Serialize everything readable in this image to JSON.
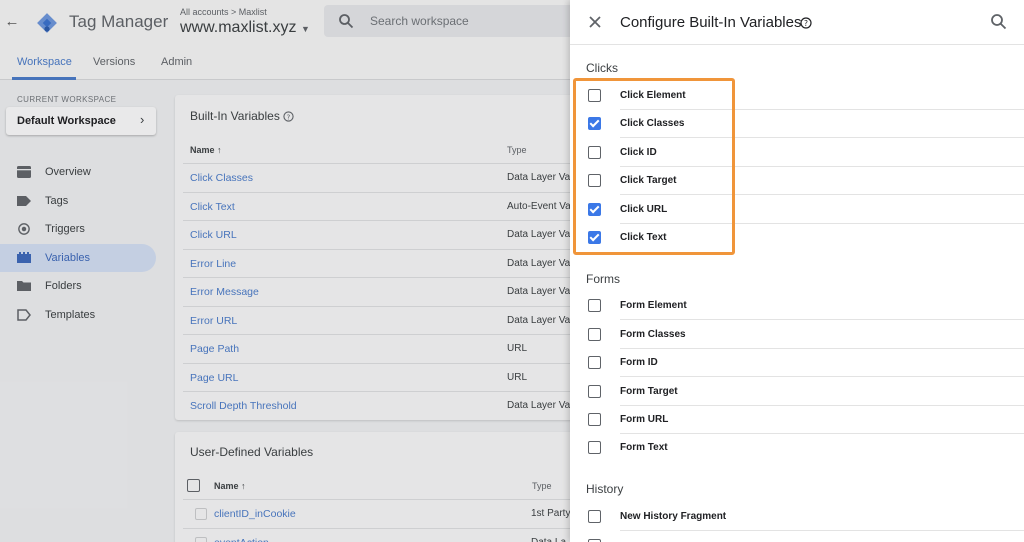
{
  "app": {
    "brand": "Tag Manager",
    "breadcrumb": "All accounts > Maxlist",
    "container_name": "www.maxlist.xyz",
    "search_placeholder": "Search workspace"
  },
  "nav_tabs": [
    {
      "label": "Workspace",
      "active": true
    },
    {
      "label": "Versions",
      "active": false
    },
    {
      "label": "Admin",
      "active": false
    }
  ],
  "sidebar": {
    "current_workspace_label": "CURRENT WORKSPACE",
    "workspace_name": "Default Workspace",
    "items": [
      {
        "label": "Overview",
        "icon": "overview-icon",
        "active": false
      },
      {
        "label": "Tags",
        "icon": "tag-icon",
        "active": false
      },
      {
        "label": "Triggers",
        "icon": "trigger-icon",
        "active": false
      },
      {
        "label": "Variables",
        "icon": "variables-icon",
        "active": true
      },
      {
        "label": "Folders",
        "icon": "folder-icon",
        "active": false
      },
      {
        "label": "Templates",
        "icon": "template-icon",
        "active": false
      }
    ]
  },
  "builtin_card": {
    "title": "Built-In Variables",
    "col_name": "Name ↑",
    "col_type": "Type",
    "rows": [
      {
        "name": "Click Classes",
        "type": "Data Layer Va"
      },
      {
        "name": "Click Text",
        "type": "Auto-Event Va"
      },
      {
        "name": "Click URL",
        "type": "Data Layer Va"
      },
      {
        "name": "Error Line",
        "type": "Data Layer Va"
      },
      {
        "name": "Error Message",
        "type": "Data Layer Va"
      },
      {
        "name": "Error URL",
        "type": "Data Layer Va"
      },
      {
        "name": "Page Path",
        "type": "URL"
      },
      {
        "name": "Page URL",
        "type": "URL"
      },
      {
        "name": "Scroll Depth Threshold",
        "type": "Data Layer Va"
      }
    ]
  },
  "udv_card": {
    "title": "User-Defined Variables",
    "col_name": "Name ↑",
    "col_type": "Type",
    "rows": [
      {
        "name": "clientID_inCookie",
        "type": "1st Party"
      },
      {
        "name": "eventAction",
        "type": "Data La"
      }
    ]
  },
  "panel": {
    "title": "Configure Built-In Variables",
    "sections": [
      {
        "title": "Clicks",
        "options": [
          {
            "label": "Click Element",
            "checked": false
          },
          {
            "label": "Click Classes",
            "checked": true
          },
          {
            "label": "Click ID",
            "checked": false
          },
          {
            "label": "Click Target",
            "checked": false
          },
          {
            "label": "Click URL",
            "checked": true
          },
          {
            "label": "Click Text",
            "checked": true
          }
        ]
      },
      {
        "title": "Forms",
        "options": [
          {
            "label": "Form Element",
            "checked": false
          },
          {
            "label": "Form Classes",
            "checked": false
          },
          {
            "label": "Form ID",
            "checked": false
          },
          {
            "label": "Form Target",
            "checked": false
          },
          {
            "label": "Form URL",
            "checked": false
          },
          {
            "label": "Form Text",
            "checked": false
          }
        ]
      },
      {
        "title": "History",
        "options": [
          {
            "label": "New History Fragment",
            "checked": false
          }
        ]
      }
    ]
  },
  "colors": {
    "accent": "#4a78c2",
    "checkbox_checked": "#3b78e7",
    "highlight_border": "#f0953a"
  }
}
